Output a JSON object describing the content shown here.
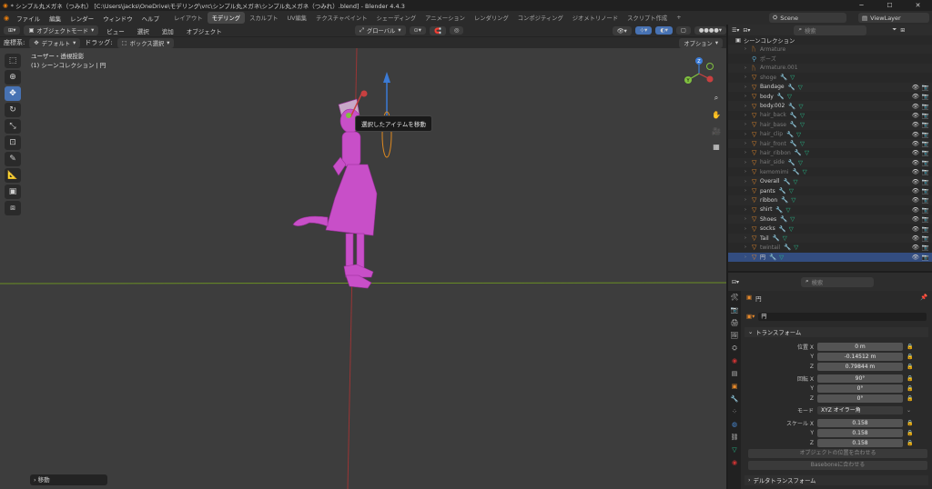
{
  "titlebar": {
    "title": "* シンプル丸メガネ（つみれ） [C:\\Users\\jacks\\OneDrive\\モデリング\\vrc\\シンプル丸メガネ\\シンプル丸メガネ（つみれ）.blend] - Blender 4.4.3"
  },
  "menubar": {
    "menus": [
      "ファイル",
      "編集",
      "レンダー",
      "ウィンドウ",
      "ヘルプ"
    ],
    "workspaces": [
      "レイアウト",
      "モデリング",
      "スカルプト",
      "UV編集",
      "テクスチャペイント",
      "シェーディング",
      "アニメーション",
      "レンダリング",
      "コンポジティング",
      "ジオメトリノード",
      "スクリプト作成"
    ],
    "active_workspace": "モデリング",
    "scene": "Scene",
    "view_layer": "ViewLayer"
  },
  "viewport_header": {
    "mode": "オブジェクトモード",
    "menus": [
      "ビュー",
      "選択",
      "追加",
      "オブジェクト"
    ],
    "orientation": "グローバル"
  },
  "tool_settings": {
    "coord_label": "座標系:",
    "coord_value": "デフォルト",
    "drag_label": "ドラッグ:",
    "drag_value": "ボックス選択",
    "options": "オプション"
  },
  "viewport": {
    "view_name": "ユーザー・透視投影",
    "collection_info": "(1) シーンコレクション | 円",
    "tooltip": "選択したアイテムを移動",
    "last_operator": "移動",
    "gizmo_axes": [
      "X",
      "Y",
      "Z"
    ]
  },
  "outliner": {
    "search_placeholder": "検索",
    "root": "シーンコレクション",
    "items": [
      {
        "name": "Armature",
        "type": "armature",
        "dim": true,
        "vis": false
      },
      {
        "name": "ポーズ",
        "type": "pose",
        "dim": true,
        "vis": false
      },
      {
        "name": "Armature.001",
        "type": "armature",
        "dim": true,
        "vis": false
      },
      {
        "name": "shoge",
        "type": "mesh",
        "dim": true,
        "vis": false
      },
      {
        "name": "Bandage",
        "type": "mesh",
        "dim": false,
        "vis": true
      },
      {
        "name": "body",
        "type": "mesh",
        "dim": false,
        "vis": true
      },
      {
        "name": "body.002",
        "type": "mesh",
        "dim": false,
        "vis": true
      },
      {
        "name": "hair_back",
        "type": "mesh",
        "dim": true,
        "vis": true
      },
      {
        "name": "hair_base",
        "type": "mesh",
        "dim": true,
        "vis": true
      },
      {
        "name": "hair_clip",
        "type": "mesh",
        "dim": true,
        "vis": true
      },
      {
        "name": "hair_front",
        "type": "mesh",
        "dim": true,
        "vis": true
      },
      {
        "name": "hair_ribbon",
        "type": "mesh",
        "dim": true,
        "vis": true
      },
      {
        "name": "hair_side",
        "type": "mesh",
        "dim": true,
        "vis": true
      },
      {
        "name": "kemomimi",
        "type": "mesh",
        "dim": true,
        "vis": true
      },
      {
        "name": "Overall",
        "type": "mesh",
        "dim": false,
        "vis": true
      },
      {
        "name": "pants",
        "type": "mesh",
        "dim": false,
        "vis": true
      },
      {
        "name": "ribbon",
        "type": "mesh",
        "dim": false,
        "vis": true
      },
      {
        "name": "shirt",
        "type": "mesh",
        "dim": false,
        "vis": true
      },
      {
        "name": "Shoes",
        "type": "mesh",
        "dim": false,
        "vis": true
      },
      {
        "name": "socks",
        "type": "mesh",
        "dim": false,
        "vis": true
      },
      {
        "name": "Tail",
        "type": "mesh",
        "dim": false,
        "vis": true
      },
      {
        "name": "twintail",
        "type": "mesh",
        "dim": true,
        "vis": true
      },
      {
        "name": "円",
        "type": "mesh",
        "dim": false,
        "vis": true,
        "selected": true
      }
    ]
  },
  "properties": {
    "search_placeholder": "検索",
    "object_name": "円",
    "object_name_field": "円",
    "transform_header": "トランスフォーム",
    "location_label": "位置 X",
    "location": [
      "0 m",
      "-0.14512 m",
      "0.79844 m"
    ],
    "rotation_label": "回転 X",
    "rotation": [
      "90°",
      "0°",
      "0°"
    ],
    "mode_label": "モード",
    "mode_value": "XYZ オイラー角",
    "scale_label": "スケール X",
    "scale": [
      "0.158",
      "0.158",
      "0.158"
    ],
    "axis_y": "Y",
    "axis_z": "Z",
    "btn_match_origin": "オブジェクトの位置を合わせる",
    "btn_match_bones": "Baseboneに合わせる",
    "delta_header": "デルタトランスフォーム"
  }
}
